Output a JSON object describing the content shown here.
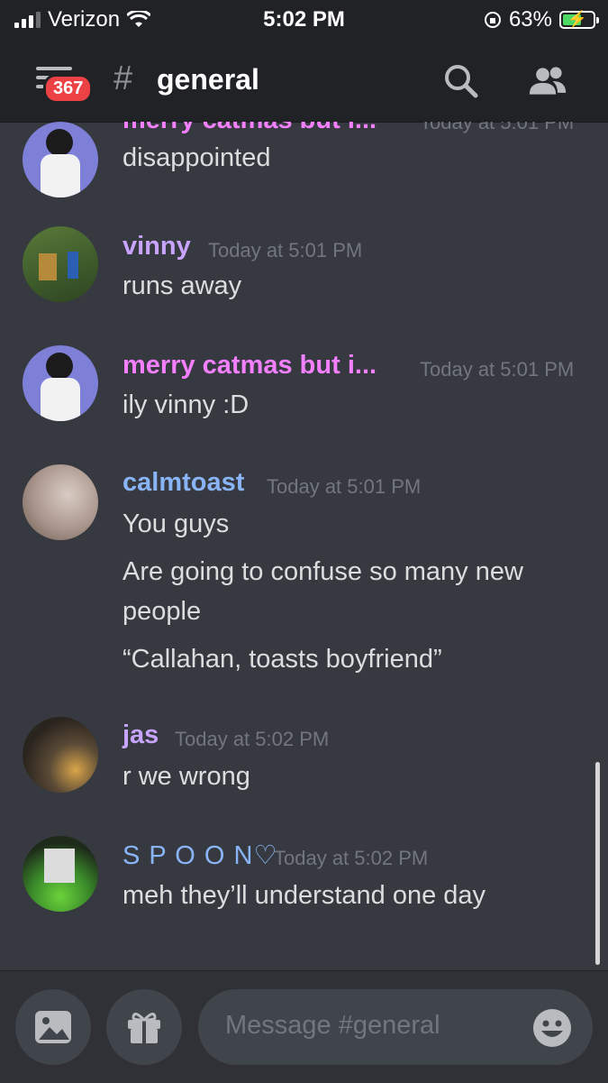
{
  "status_bar": {
    "carrier": "Verizon",
    "time": "5:02 PM",
    "battery_percent": "63%",
    "battery_level": 0.63,
    "charging": true
  },
  "header": {
    "badge_count": "367",
    "channel_prefix": "#",
    "channel_name": "general"
  },
  "messages": [
    {
      "author": "merry catmas but i...",
      "author_color": "#f47fff",
      "timestamp": "Today at 5:01 PM",
      "lines": [
        "disappointed"
      ]
    },
    {
      "author": "vinny",
      "author_color": "#c9a4ff",
      "timestamp": "Today at 5:01 PM",
      "lines": [
        "runs away"
      ]
    },
    {
      "author": "merry catmas but i...",
      "author_color": "#f47fff",
      "timestamp": "Today at 5:01 PM",
      "lines": [
        "ily vinny :D"
      ]
    },
    {
      "author": "calmtoast",
      "author_color": "#8ab4f8",
      "timestamp": "Today at 5:01 PM",
      "lines": [
        "You guys",
        "Are going to confuse so many new people",
        "“Callahan, toasts boyfriend”"
      ]
    },
    {
      "author": "jas",
      "author_color": "#c9a4ff",
      "timestamp": "Today at 5:02 PM",
      "lines": [
        "r we wrong"
      ]
    },
    {
      "author": "S P O O N♡",
      "author_color": "#8ab4f8",
      "timestamp": "Today at 5:02 PM",
      "lines": [
        "meh they’ll understand one day"
      ]
    }
  ],
  "composer": {
    "placeholder": "Message #general"
  }
}
